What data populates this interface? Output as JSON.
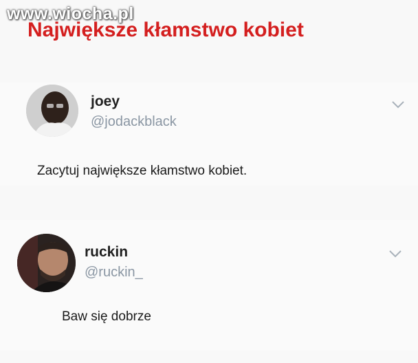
{
  "watermark": "www.wiocha.pl",
  "headline": "Największe kłamstwo kobiet",
  "tweets": [
    {
      "name": "joey",
      "handle": "@jodackblack",
      "text": "Zacytuj największe kłamstwo kobiet."
    },
    {
      "name": "ruckin",
      "handle": "@ruckin_",
      "text": "Baw się dobrze"
    }
  ],
  "colors": {
    "headline": "#d41f1f",
    "handle": "#8a96a3"
  }
}
